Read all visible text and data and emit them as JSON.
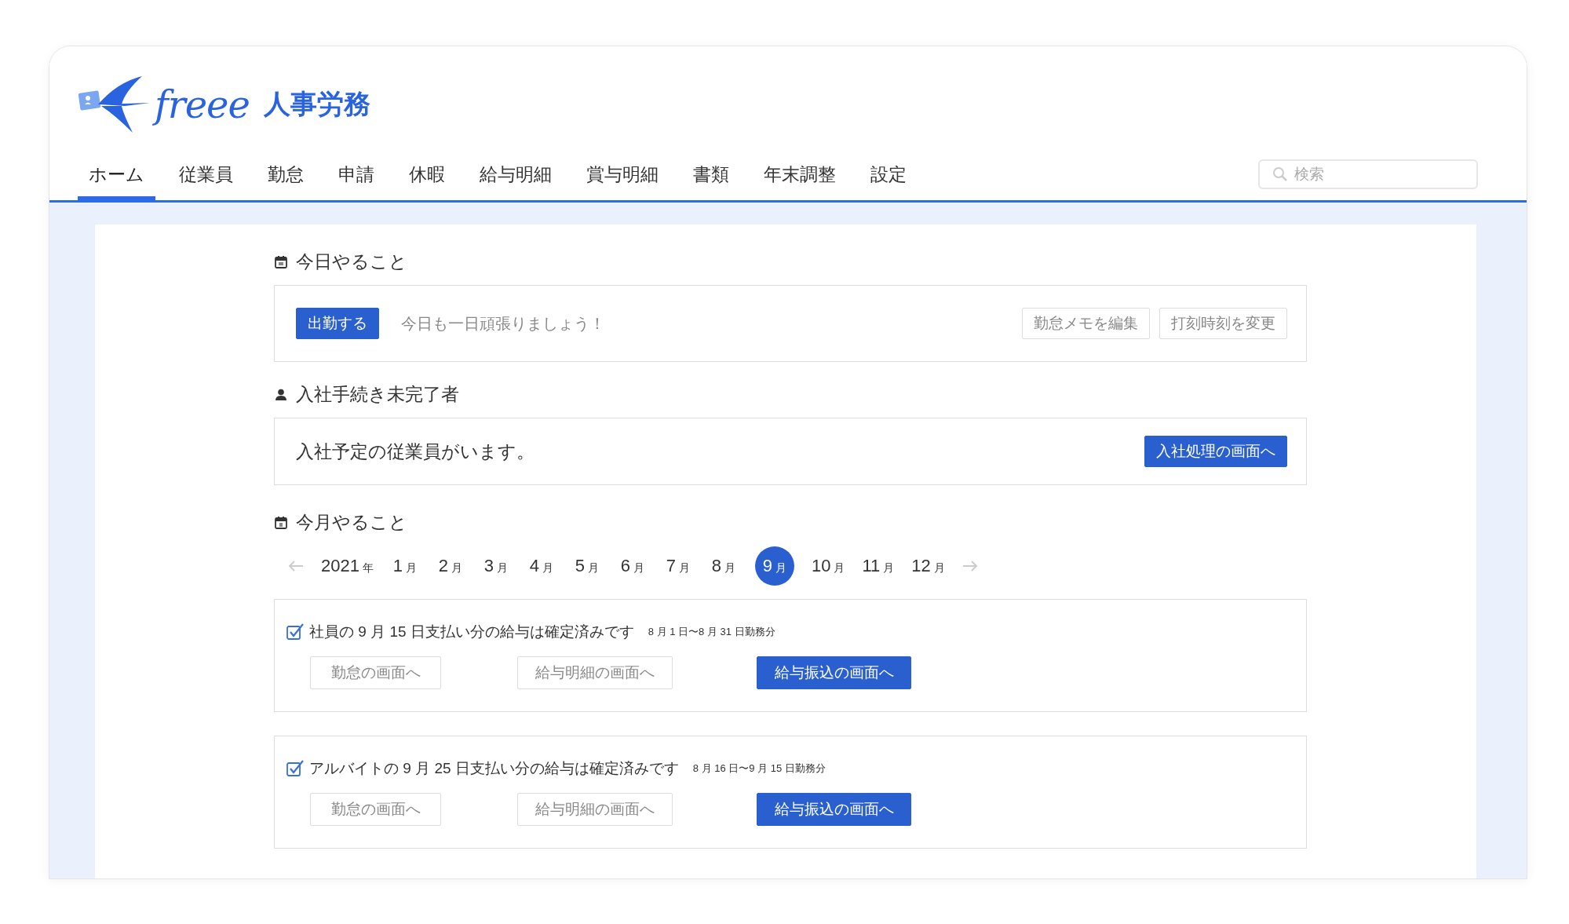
{
  "logo": {
    "wordmark": "freee",
    "product": "人事労務"
  },
  "nav": [
    {
      "label": "ホーム",
      "selected": true
    },
    {
      "label": "従業員",
      "selected": false
    },
    {
      "label": "勤怠",
      "selected": false
    },
    {
      "label": "申請",
      "selected": false
    },
    {
      "label": "休暇",
      "selected": false
    },
    {
      "label": "給与明細",
      "selected": false
    },
    {
      "label": "賞与明細",
      "selected": false
    },
    {
      "label": "書類",
      "selected": false
    },
    {
      "label": "年末調整",
      "selected": false
    },
    {
      "label": "設定",
      "selected": false
    }
  ],
  "search": {
    "placeholder": "検索"
  },
  "today": {
    "title": "今日やること",
    "clock_in": "出勤する",
    "message": "今日も一日頑張りましょう！",
    "buttons": [
      "勤怠メモを編集",
      "打刻時刻を変更"
    ]
  },
  "onboarding": {
    "title": "入社手続き未完了者",
    "message": "入社予定の従業員がいます。",
    "button": "入社処理の画面へ"
  },
  "month": {
    "title": "今月やること",
    "year": {
      "number": "2021",
      "unit": "年"
    },
    "months": [
      {
        "number": "1",
        "unit": "月",
        "selected": false
      },
      {
        "number": "2",
        "unit": "月",
        "selected": false
      },
      {
        "number": "3",
        "unit": "月",
        "selected": false
      },
      {
        "number": "4",
        "unit": "月",
        "selected": false
      },
      {
        "number": "5",
        "unit": "月",
        "selected": false
      },
      {
        "number": "6",
        "unit": "月",
        "selected": false
      },
      {
        "number": "7",
        "unit": "月",
        "selected": false
      },
      {
        "number": "8",
        "unit": "月",
        "selected": false
      },
      {
        "number": "9",
        "unit": "月",
        "selected": true
      },
      {
        "number": "10",
        "unit": "月",
        "selected": false
      },
      {
        "number": "11",
        "unit": "月",
        "selected": false
      },
      {
        "number": "12",
        "unit": "月",
        "selected": false
      }
    ],
    "tasks": [
      {
        "checked": true,
        "text": "社員の 9 月 15 日支払い分の給与は確定済みです",
        "period": "8 月 1 日〜8 月 31 日勤務分",
        "buttons": [
          {
            "label": "勤怠の画面へ",
            "primary": false
          },
          {
            "label": "給与明細の画面へ",
            "primary": false
          },
          {
            "label": "給与振込の画面へ",
            "primary": true
          }
        ]
      },
      {
        "checked": true,
        "text": "アルバイトの 9 月 25 日支払い分の給与は確定済みです",
        "period": "8 月 16 日〜9 月 15 日勤務分",
        "buttons": [
          {
            "label": "勤怠の画面へ",
            "primary": false
          },
          {
            "label": "給与明細の画面へ",
            "primary": false
          },
          {
            "label": "給与振込の画面へ",
            "primary": true
          }
        ]
      }
    ]
  }
}
